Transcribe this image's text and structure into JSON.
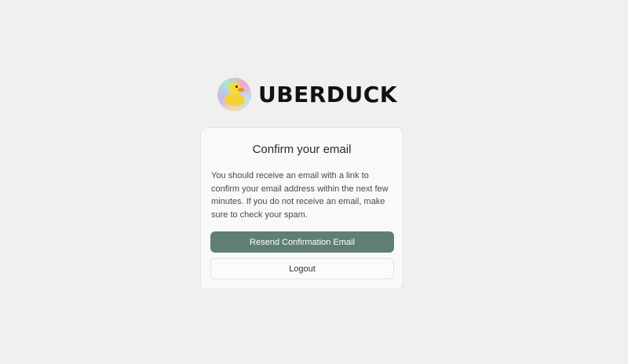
{
  "brand": {
    "name": "UBERDUCK",
    "logo_icon": "duck-logo-icon"
  },
  "card": {
    "title": "Confirm your email",
    "body": "You should receive an email with a link to confirm your email address within the next few minutes. If you do not receive an email, make sure to check your spam.",
    "resend_label": "Resend Confirmation Email",
    "logout_label": "Logout"
  },
  "colors": {
    "background": "#f1f0f1",
    "primary_button": "#5f7f74",
    "card": "#f9f9f7"
  }
}
